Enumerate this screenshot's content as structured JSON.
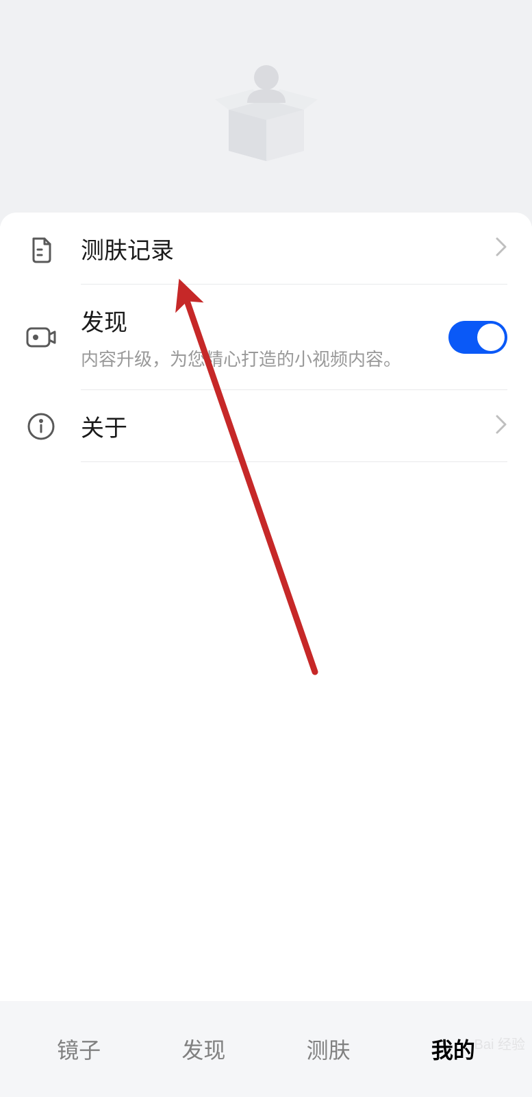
{
  "menu": {
    "items": [
      {
        "title": "测肤记录",
        "icon": "document-icon",
        "action": "navigate"
      },
      {
        "title": "发现",
        "subtitle": "内容升级，为您精心打造的小视频内容。",
        "icon": "camera-icon",
        "action": "toggle",
        "toggle_state": true
      },
      {
        "title": "关于",
        "icon": "info-icon",
        "action": "navigate"
      }
    ]
  },
  "bottom_nav": {
    "items": [
      {
        "label": "镜子",
        "active": false
      },
      {
        "label": "发现",
        "active": false
      },
      {
        "label": "测肤",
        "active": false
      },
      {
        "label": "我的",
        "active": true
      }
    ]
  },
  "watermark": {
    "text": "Bai 经验"
  }
}
